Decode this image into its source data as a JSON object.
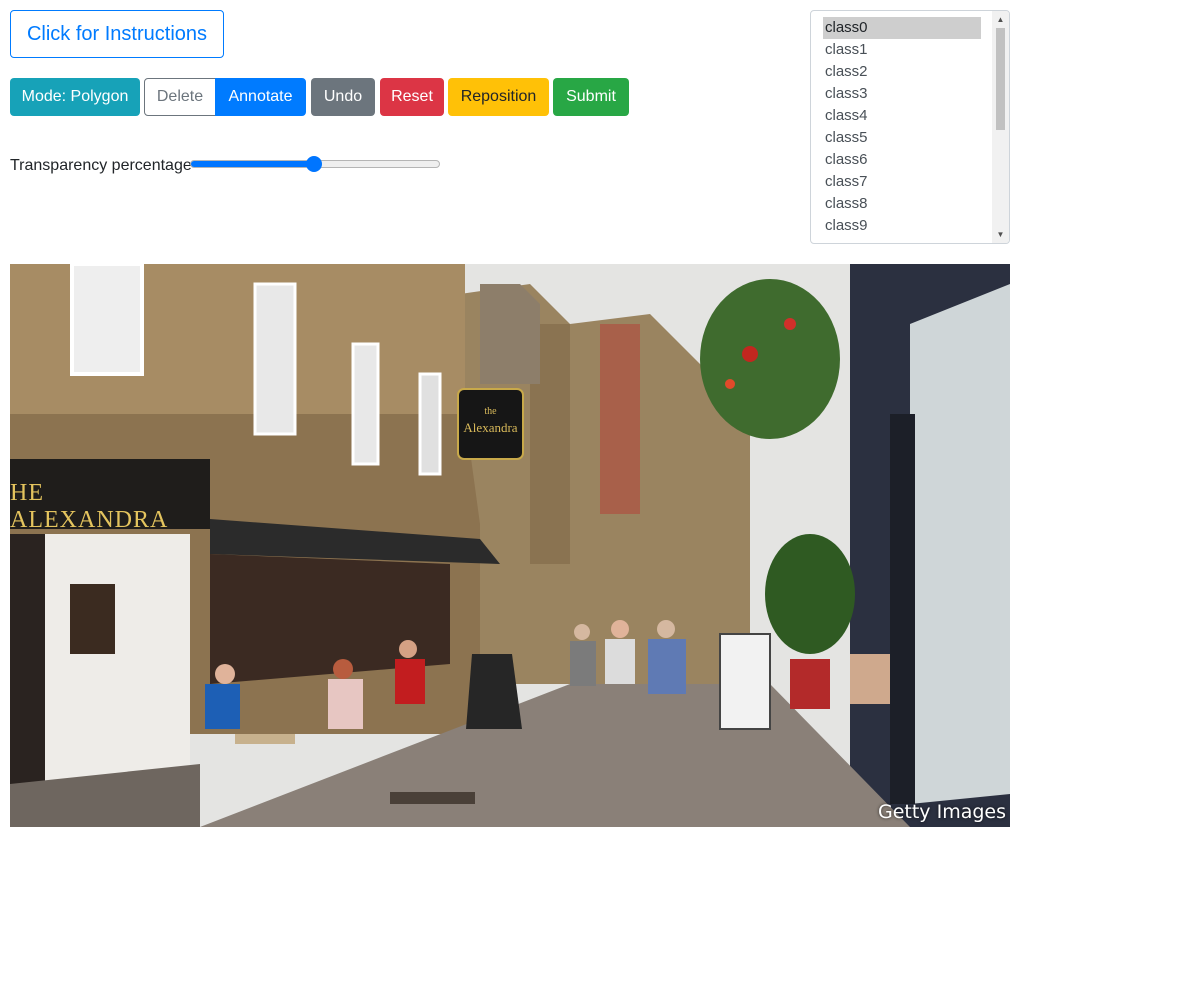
{
  "toolbar": {
    "instructions_label": "Click for Instructions",
    "mode_label": "Mode: Polygon",
    "delete_label": "Delete",
    "annotate_label": "Annotate",
    "undo_label": "Undo",
    "reset_label": "Reset",
    "reposition_label": "Reposition",
    "submit_label": "Submit"
  },
  "transparency": {
    "label": "Transparency percentage",
    "value_percent": 50
  },
  "class_list": {
    "items": [
      "class0",
      "class1",
      "class2",
      "class3",
      "class4",
      "class5",
      "class6",
      "class7",
      "class8",
      "class9"
    ],
    "selected": "class0"
  },
  "image": {
    "shop_sign": "HE ALEXANDRA",
    "hanging_sign_line1": "the",
    "hanging_sign_line2": "Alexandra",
    "watermark": "Getty Images"
  },
  "colors": {
    "info": "#17a2b8",
    "primary": "#007bff",
    "secondary": "#6c757d",
    "danger": "#dc3545",
    "warning": "#ffc107",
    "success": "#28a745"
  }
}
